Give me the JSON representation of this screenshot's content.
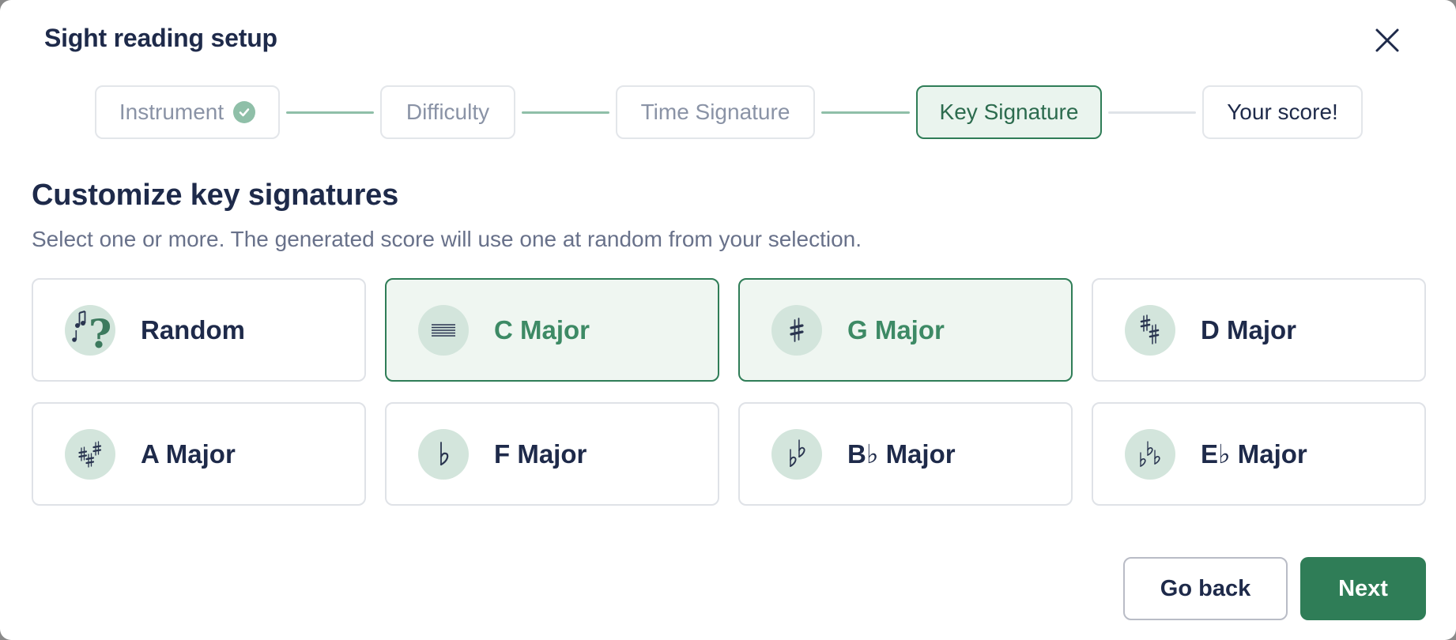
{
  "dialog": {
    "title": "Sight reading setup",
    "close_icon": "close-icon"
  },
  "stepper": {
    "steps": [
      {
        "label": "Instrument",
        "state": "completed"
      },
      {
        "label": "Difficulty",
        "state": "completed"
      },
      {
        "label": "Time Signature",
        "state": "completed"
      },
      {
        "label": "Key Signature",
        "state": "active"
      },
      {
        "label": "Your score!",
        "state": "upcoming"
      }
    ]
  },
  "content": {
    "title": "Customize key signatures",
    "subtitle": "Select one or more. The generated score will use one at random from your selection."
  },
  "options": [
    {
      "label": "Random",
      "icon": "random-question-notes-icon",
      "selected": false
    },
    {
      "label": "C Major",
      "icon": "staff-no-accidentals-icon",
      "selected": true
    },
    {
      "label": "G Major",
      "icon": "one-sharp-icon",
      "selected": true
    },
    {
      "label": "D Major",
      "icon": "two-sharps-icon",
      "selected": false
    },
    {
      "label": "A Major",
      "icon": "three-sharps-icon",
      "selected": false
    },
    {
      "label": "F Major",
      "icon": "one-flat-icon",
      "selected": false
    },
    {
      "label": "B♭ Major",
      "icon": "two-flats-icon",
      "selected": false
    },
    {
      "label": "E♭ Major",
      "icon": "three-flats-icon",
      "selected": false
    }
  ],
  "footer": {
    "back_label": "Go back",
    "next_label": "Next"
  },
  "colors": {
    "accent": "#2f7d57",
    "accent_light": "#eff6f1",
    "badge": "#d3e5dc",
    "text": "#1e2a4a",
    "muted": "#68718a"
  }
}
